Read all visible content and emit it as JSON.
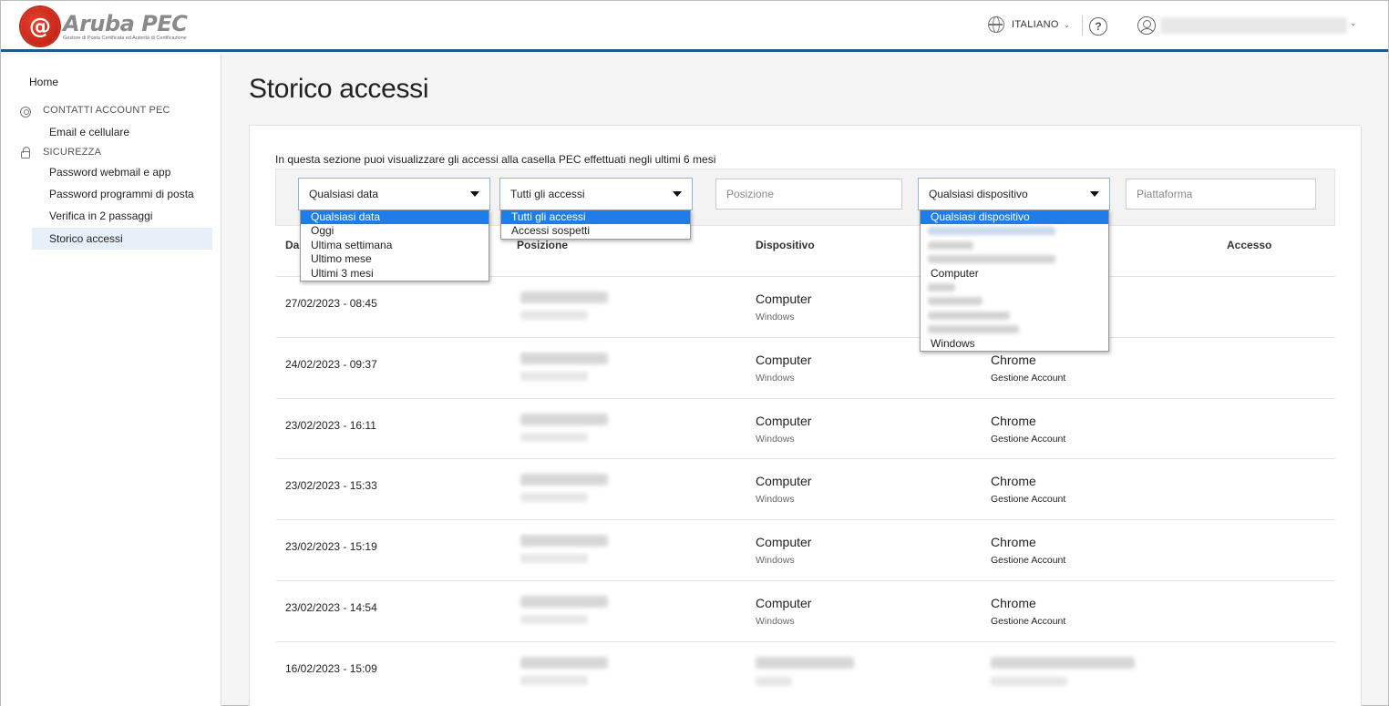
{
  "header": {
    "logo_name": "Aruba PEC",
    "logo_tagline": "Gestore di Posta Certificata ed Autorità di Certificazione",
    "language": "ITALIANO",
    "help_glyph": "?"
  },
  "sidebar": {
    "home": "Home",
    "section_contacts": "CONTATTI ACCOUNT PEC",
    "section_security": "SICUREZZA",
    "items": [
      {
        "label": "Email e cellulare"
      },
      {
        "label": "Password webmail e app"
      },
      {
        "label": "Password programmi di posta"
      },
      {
        "label": "Verifica in 2 passaggi"
      },
      {
        "label": "Storico accessi"
      }
    ]
  },
  "main": {
    "title": "Storico accessi",
    "description": "In questa sezione puoi visualizzare gli accessi alla casella PEC effettuati negli ultimi 6 mesi",
    "filters": {
      "date_value": "Qualsiasi data",
      "access_value": "Tutti gli accessi",
      "position_placeholder": "Posizione",
      "device_value": "Qualsiasi dispositivo",
      "platform_placeholder": "Piattaforma"
    },
    "date_options": [
      "Qualsiasi data",
      "Oggi",
      "Ultima settimana",
      "Ultimo mese",
      "Ultimi 3 mesi"
    ],
    "access_options": [
      "Tutti gli accessi",
      "Accessi sospetti"
    ],
    "device_options": {
      "selected": "Qualsiasi dispositivo",
      "computer": "Computer",
      "windows": "Windows"
    },
    "columns": {
      "date": "Da",
      "position": "Posizione",
      "device": "Dispositivo",
      "access": "Accesso"
    },
    "rows": [
      {
        "date": "27/02/2023 - 08:45",
        "device": "Computer",
        "os": "Windows",
        "browser": "",
        "access_type": ""
      },
      {
        "date": "24/02/2023 - 09:37",
        "device": "Computer",
        "os": "Windows",
        "browser": "Chrome",
        "access_type": "Gestione Account"
      },
      {
        "date": "23/02/2023 - 16:11",
        "device": "Computer",
        "os": "Windows",
        "browser": "Chrome",
        "access_type": "Gestione Account"
      },
      {
        "date": "23/02/2023 - 15:33",
        "device": "Computer",
        "os": "Windows",
        "browser": "Chrome",
        "access_type": "Gestione Account"
      },
      {
        "date": "23/02/2023 - 15:19",
        "device": "Computer",
        "os": "Windows",
        "browser": "Chrome",
        "access_type": "Gestione Account"
      },
      {
        "date": "23/02/2023 - 14:54",
        "device": "Computer",
        "os": "Windows",
        "browser": "Chrome",
        "access_type": "Gestione Account"
      },
      {
        "date": "16/02/2023 - 15:09",
        "device": "",
        "os": "",
        "browser": "",
        "access_type": ""
      }
    ]
  },
  "colors": {
    "accent": "#1f5a8c",
    "selection": "#1e7de8",
    "active_nav": "#e7f0f9"
  }
}
